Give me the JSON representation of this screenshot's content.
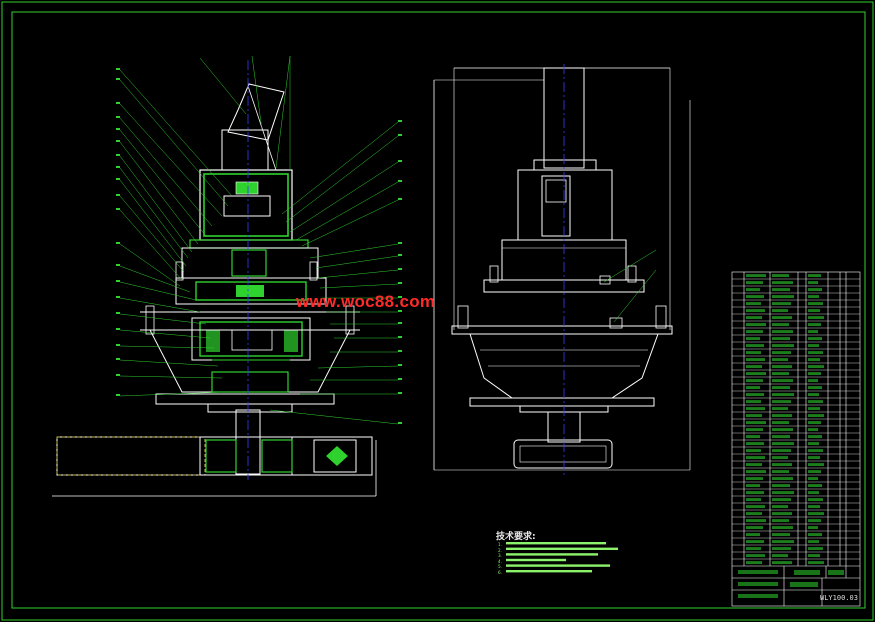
{
  "watermark": "www.woc88.com",
  "technical_requirements": {
    "title": "技术要求:",
    "notes": [
      "1.",
      "2.",
      "3.",
      "4.",
      "5.",
      "6."
    ]
  },
  "title_block": {
    "drawing_number": "WLY100.03"
  },
  "colors": {
    "background": "#000000",
    "frame": "#2fd12f",
    "outline": "#ffffff",
    "centerline": "#3a3aff",
    "leader": "#2fd12f",
    "watermark": "#ff2a2a",
    "section_fill": "#2fd12f"
  }
}
